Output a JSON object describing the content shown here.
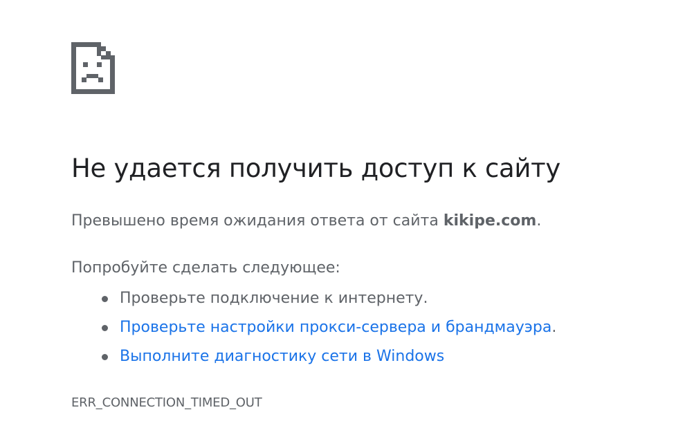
{
  "icon": {
    "name": "sad-page-icon"
  },
  "title": "Не удается получить доступ к сайту",
  "message": {
    "prefix": "Превышено время ожидания ответа от сайта ",
    "host": "kikipe.com",
    "suffix": "."
  },
  "suggestions": {
    "heading": "Попробуйте сделать следующее:",
    "items": [
      {
        "text": "Проверьте подключение к интернету.",
        "is_link": false
      },
      {
        "text": "Проверьте настройки прокси-сервера и брандмауэра",
        "trailing": ".",
        "is_link": true
      },
      {
        "text": "Выполните диагностику сети в Windows",
        "is_link": true
      }
    ]
  },
  "error_code": "ERR_CONNECTION_TIMED_OUT",
  "colors": {
    "title": "#202124",
    "text": "#5f6368",
    "link": "#1a73e8",
    "background": "#ffffff"
  }
}
